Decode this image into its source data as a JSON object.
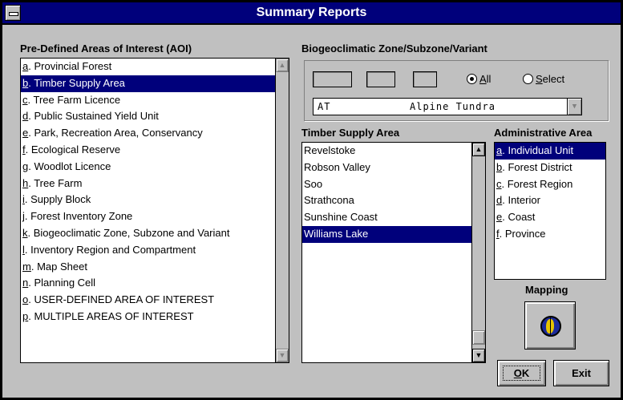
{
  "window": {
    "title": "Summary Reports"
  },
  "aoi": {
    "label": "Pre-Defined Areas of Interest (AOI)",
    "items": [
      {
        "key": "a",
        "rest": ". Provincial Forest",
        "selected": false
      },
      {
        "key": "b",
        "rest": ". Timber Supply Area",
        "selected": true
      },
      {
        "key": "c",
        "rest": ". Tree Farm Licence",
        "selected": false
      },
      {
        "key": "d",
        "rest": ". Public Sustained Yield Unit",
        "selected": false
      },
      {
        "key": "e",
        "rest": ". Park, Recreation Area, Conservancy",
        "selected": false
      },
      {
        "key": "f",
        "rest": ". Ecological Reserve",
        "selected": false
      },
      {
        "key": "g",
        "rest": ". Woodlot Licence",
        "selected": false
      },
      {
        "key": "h",
        "rest": ". Tree Farm",
        "selected": false
      },
      {
        "key": "i",
        "rest": ". Supply Block",
        "selected": false
      },
      {
        "key": "j",
        "rest": ". Forest Inventory Zone",
        "selected": false
      },
      {
        "key": "k",
        "rest": ". Biogeoclimatic Zone, Subzone and Variant",
        "selected": false
      },
      {
        "key": "l",
        "rest": ". Inventory Region and Compartment",
        "selected": false
      },
      {
        "key": "m",
        "rest": ". Map Sheet",
        "selected": false
      },
      {
        "key": "n",
        "rest": ". Planning Cell",
        "selected": false
      },
      {
        "key": "o",
        "rest": ". USER-DEFINED AREA OF INTEREST",
        "selected": false
      },
      {
        "key": "p",
        "rest": ". MULTIPLE AREAS OF INTEREST",
        "selected": false
      }
    ]
  },
  "bgc": {
    "label": "Biogeoclimatic Zone/Subzone/Variant",
    "radio_all": {
      "key": "A",
      "rest": "ll",
      "checked": true
    },
    "radio_select": {
      "key": "S",
      "rest": "elect",
      "checked": false
    },
    "combo": {
      "code": "AT",
      "name": "Alpine Tundra"
    }
  },
  "tsa": {
    "label": "Timber Supply Area",
    "items": [
      {
        "text": "Revelstoke",
        "selected": false
      },
      {
        "text": "Robson Valley",
        "selected": false
      },
      {
        "text": "Soo",
        "selected": false
      },
      {
        "text": "Strathcona",
        "selected": false
      },
      {
        "text": "Sunshine Coast",
        "selected": false
      },
      {
        "text": "Williams Lake",
        "selected": true
      }
    ]
  },
  "admin": {
    "label": "Administrative Area",
    "items": [
      {
        "key": "a",
        "rest": ". Individual Unit",
        "selected": true
      },
      {
        "key": "b",
        "rest": ". Forest District",
        "selected": false
      },
      {
        "key": "c",
        "rest": ". Forest Region",
        "selected": false
      },
      {
        "key": "d",
        "rest": ". Interior",
        "selected": false
      },
      {
        "key": "e",
        "rest": ". Coast",
        "selected": false
      },
      {
        "key": "f",
        "rest": ". Province",
        "selected": false
      }
    ]
  },
  "mapping": {
    "label": "Mapping",
    "icon": "globe-icon"
  },
  "buttons": {
    "ok_key": "O",
    "ok_rest": "K",
    "exit": "Exit"
  },
  "colors": {
    "selection": "#00007b",
    "titlebar": "#00007b",
    "face": "#c0c0c0"
  }
}
